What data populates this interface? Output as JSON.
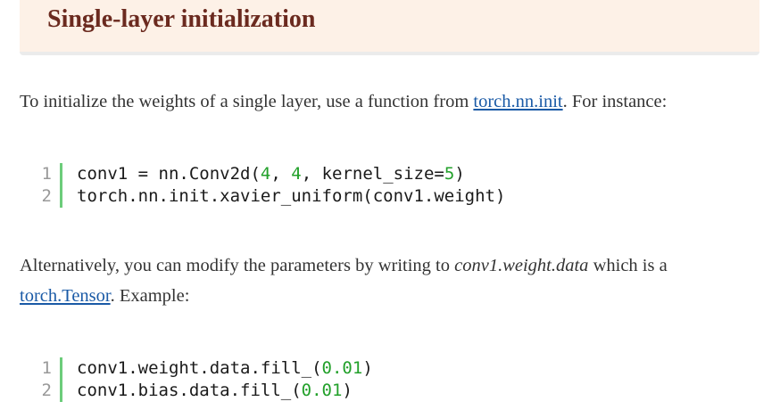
{
  "heading": {
    "title": "Single-layer initialization"
  },
  "para1": {
    "text_before": "To initialize the weights of a single layer, use a function from ",
    "link": "torch.nn.init",
    "text_after": ". For instance:"
  },
  "code1": {
    "lines": [
      {
        "number": "1",
        "a": "conv1 = nn.Conv2d(",
        "n1": "4",
        "b": ", ",
        "n2": "4",
        "c": ", kernel_size=",
        "n3": "5",
        "d": ")"
      },
      {
        "number": "2",
        "text": "torch.nn.init.xavier_uniform(conv1.weight)"
      }
    ]
  },
  "para2": {
    "text_before": "Alternatively, you can modify the parameters by writing to ",
    "emphasis": "conv1.weight.data",
    "text_after": " which is a",
    "link": "torch.Tensor",
    "text_end": ". Example:"
  },
  "code2": {
    "lines": [
      {
        "number": "1",
        "a": "conv1.weight.data.fill_(",
        "n": "0.01",
        "b": ")"
      },
      {
        "number": "2",
        "a": "conv1.bias.data.fill_(",
        "n": "0.01",
        "b": ")"
      }
    ]
  },
  "colors": {
    "heading_bg": "#fdf1e7",
    "heading_text": "#6b2a1f",
    "link": "#1a5aa6",
    "number": "#22a02a",
    "gutter_bar": "#6ccc7a"
  }
}
